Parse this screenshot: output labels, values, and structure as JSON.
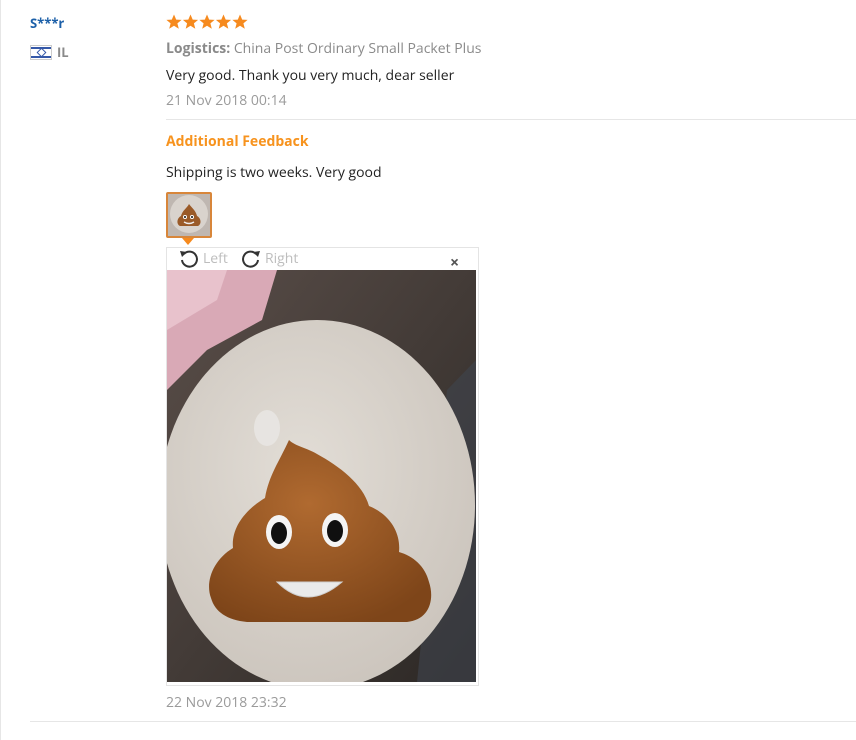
{
  "reviewer": {
    "name": "S***r",
    "country": "IL"
  },
  "rating": {
    "stars": 5,
    "max": 5,
    "color": "#f68a1e"
  },
  "logistics": {
    "label": "Logistics:",
    "value": "China Post Ordinary Small Packet Plus"
  },
  "review": {
    "text": "Very good. Thank you very much, dear seller",
    "date": "21 Nov 2018 00:14"
  },
  "additional": {
    "title": "Additional Feedback",
    "text": "Shipping is two weeks. Very good",
    "date": "22 Nov 2018 23:32"
  },
  "viewer": {
    "rotate_left": "Left",
    "rotate_right": "Right",
    "close": "×"
  },
  "colors": {
    "accent": "#f7931e",
    "username": "#1b5fa8",
    "muted": "#9a9a9a"
  }
}
